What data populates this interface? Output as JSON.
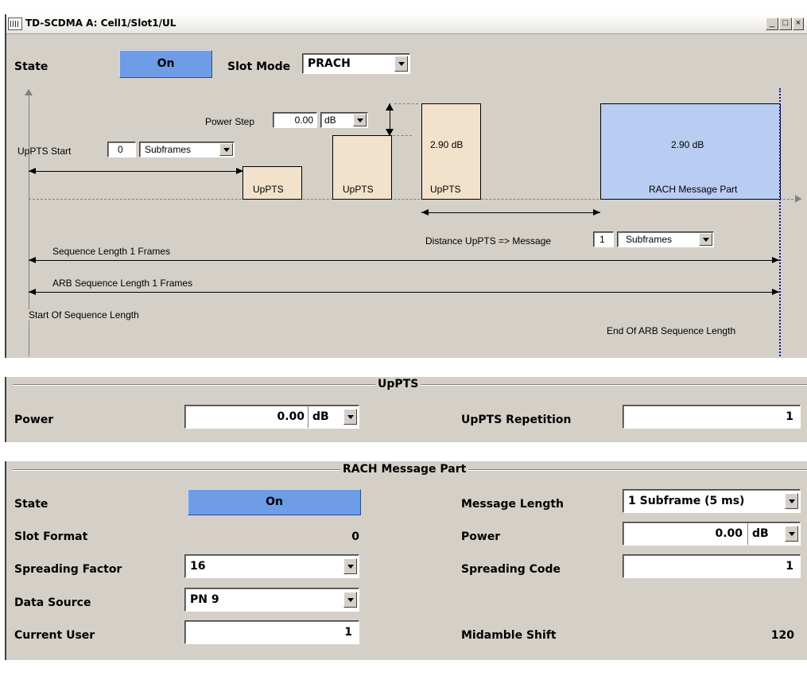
{
  "window": {
    "title": "TD-SCDMA A: Cell1/Slot1/UL",
    "min_glyph": "_",
    "max_glyph": "□",
    "close_glyph": "×"
  },
  "header": {
    "state_label": "State",
    "state_value": "On",
    "slot_mode_label": "Slot Mode",
    "slot_mode_value": "PRACH"
  },
  "diagram": {
    "power_step_label": "Power Step",
    "power_step_value": "0.00",
    "power_step_unit": "dB",
    "upts_start_label": "UpPTS Start",
    "upts_start_value": "0",
    "upts_start_unit": "Subframes",
    "box1_label": "UpPTS",
    "box2_label": "UpPTS",
    "box3_label": "UpPTS",
    "box3_value": "2.90 dB",
    "rach_label": "RACH Message Part",
    "rach_value": "2.90 dB",
    "distance_label": "Distance UpPTS => Message",
    "distance_value": "1",
    "distance_unit": "Subframes",
    "seq_length_label": "Sequence Length 1 Frames",
    "arb_seq_length_label": "ARB Sequence Length 1 Frames",
    "start_label": "Start Of Sequence Length",
    "end_label": "End Of ARB Sequence Length"
  },
  "upts_panel": {
    "title": "UpPTS",
    "power_label": "Power",
    "power_value": "0.00",
    "power_unit": "dB",
    "repetition_label": "UpPTS Repetition",
    "repetition_value": "1"
  },
  "rach_panel": {
    "title": "RACH Message Part",
    "state_label": "State",
    "state_value": "On",
    "slot_format_label": "Slot Format",
    "slot_format_value": "0",
    "spreading_factor_label": "Spreading Factor",
    "spreading_factor_value": "16",
    "data_source_label": "Data Source",
    "data_source_value": "PN 9",
    "current_user_label": "Current User",
    "current_user_value": "1",
    "message_length_label": "Message Length",
    "message_length_value": "1 Subframe (5 ms)",
    "power_label": "Power",
    "power_value": "0.00",
    "power_unit": "dB",
    "spreading_code_label": "Spreading Code",
    "spreading_code_value": "1",
    "midamble_shift_label": "Midamble Shift",
    "midamble_shift_value": "120"
  },
  "colors": {
    "button_on": "#6f9ce6",
    "upts_box": "#f3e2cb",
    "rach_box": "#b9cdf3",
    "marker": "#1010a0"
  }
}
